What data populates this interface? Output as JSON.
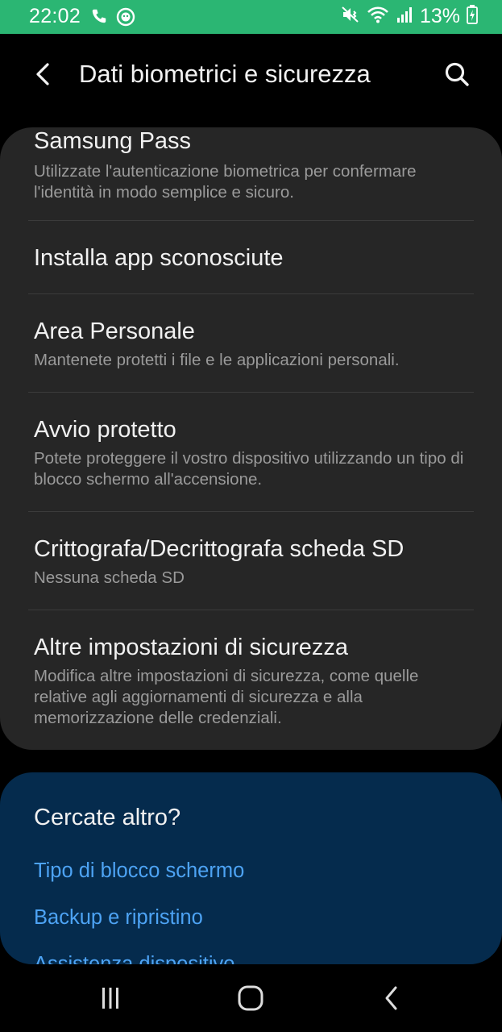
{
  "status_bar": {
    "time": "22:02",
    "battery_percent": "13%",
    "background_color": "#2bb673",
    "icons": [
      "phone-call-icon",
      "app-notification-icon",
      "mute-vibrate-icon",
      "wifi-icon",
      "signal-icon",
      "battery-charging-icon"
    ]
  },
  "header": {
    "title": "Dati biometrici e sicurezza",
    "back_icon": "chevron-left-icon",
    "search_icon": "search-icon"
  },
  "settings": {
    "items": [
      {
        "title": "Samsung Pass",
        "description": "Utilizzate l'autenticazione biometrica per confermare l'identità in modo semplice e sicuro."
      },
      {
        "title": "Installa app sconosciute",
        "description": ""
      },
      {
        "title": "Area Personale",
        "description": "Mantenete protetti i file e le applicazioni personali."
      },
      {
        "title": "Avvio protetto",
        "description": "Potete proteggere il vostro dispositivo utilizzando un tipo di blocco schermo all'accensione."
      },
      {
        "title": "Crittografa/Decrittografa scheda SD",
        "description": "Nessuna scheda SD"
      },
      {
        "title": "Altre impostazioni di sicurezza",
        "description": "Modifica altre impostazioni di sicurezza, come quelle relative agli aggiornamenti di sicurezza e alla memorizzazione delle credenziali."
      }
    ]
  },
  "suggestions": {
    "title": "Cercate altro?",
    "links": [
      "Tipo di blocco schermo",
      "Backup e ripristino",
      "Assistenza dispositivo"
    ],
    "link_color": "#4da3f4",
    "background_color": "#052b4d"
  },
  "nav_bar": {
    "icons": [
      "recent-apps-icon",
      "home-icon",
      "back-icon"
    ]
  }
}
